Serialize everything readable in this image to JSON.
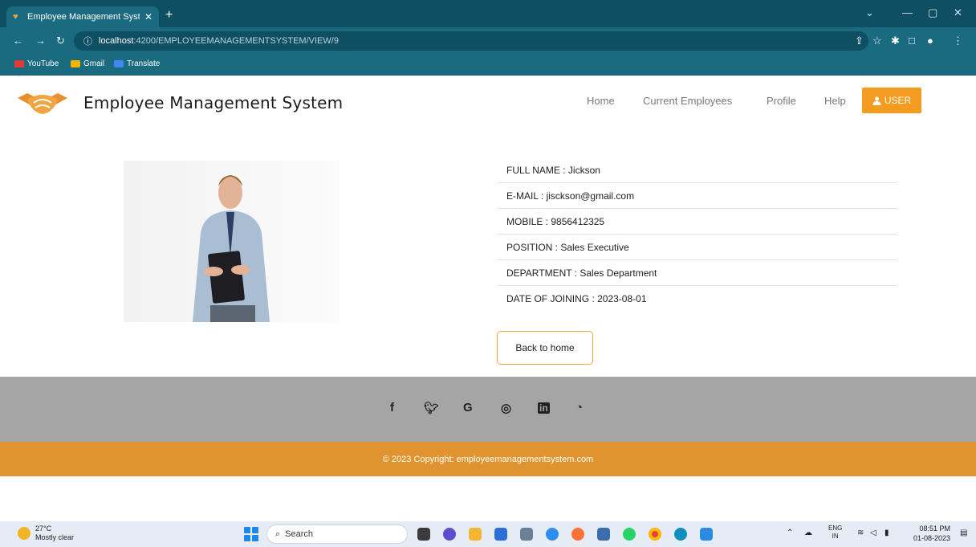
{
  "browser": {
    "tab_title": "Employee Management System",
    "url_host": "localhost",
    "url_path": ":4200/EMPLOYEEMANAGEMENTSYSTEM/VIEW/9",
    "bookmarks": [
      "YouTube",
      "Gmail",
      "Translate"
    ]
  },
  "header": {
    "title": "Employee Management System",
    "nav": [
      "Home",
      "Current Employees",
      "Profile",
      "Help"
    ],
    "user_button": "USER"
  },
  "employee": {
    "rows": [
      "FULL NAME : Jickson",
      "E-MAIL : jisckson@gmail.com",
      "MOBILE : 9856412325",
      "POSITION : Sales Executive",
      "DEPARTMENT : Sales Department",
      "DATE OF JOINING : 2023-08-01"
    ],
    "back_button": "Back to home"
  },
  "footer": {
    "copyright": "© 2023 Copyright: employeemanagementsystem.com"
  },
  "taskbar": {
    "temperature": "27°C",
    "weather": "Mostly clear",
    "search_placeholder": "Search",
    "lang_top": "ENG",
    "lang_bottom": "IN",
    "time": "08:51 PM",
    "date": "01-08-2023"
  },
  "colors": {
    "browser_dark": "#0e4f63",
    "browser_light": "#1a6a80",
    "accent": "#f39c1f",
    "footer_grey": "#a5a5a5",
    "footer_orange": "#e09430"
  }
}
